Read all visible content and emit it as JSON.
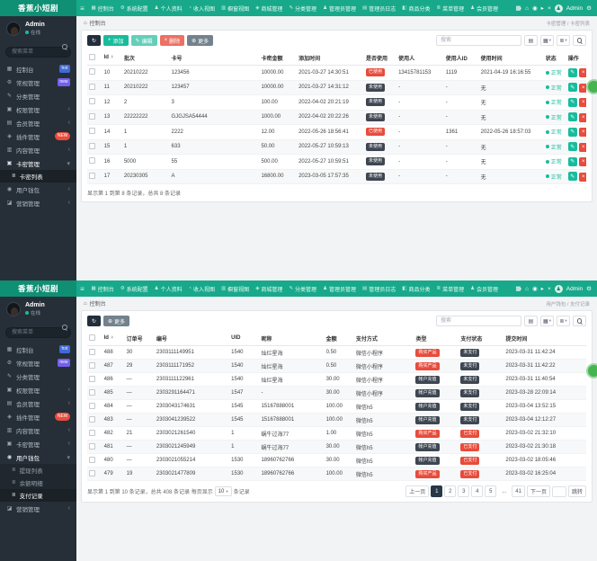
{
  "colors": {
    "navbar_green": "#18a98b",
    "logo_green": "#0f8f74",
    "sidebar_dark": "#262f38",
    "accent_green": "#18bc9c",
    "danger_red": "#e74c3c",
    "dark_badge": "#3e4651",
    "badge_hot_blue": "#3f6ad8",
    "badge_new_purple": "#7460ee",
    "pager_active_dark": "#293846",
    "fab_green": "#46b450"
  },
  "screens": [
    {
      "logo": "香蕉小短剧",
      "navbar": {
        "items": [
          {
            "label": "控制台",
            "icon": "dashboard-icon"
          },
          {
            "label": "系统配置",
            "icon": "gear-icon"
          },
          {
            "label": "个人资料",
            "icon": "user-icon"
          },
          {
            "label": "收入视图",
            "icon": "chart-line-icon"
          },
          {
            "label": "橱窗视图",
            "icon": "chart-bar-icon"
          },
          {
            "label": "商城管理",
            "icon": "cart-icon"
          },
          {
            "label": "分类管理",
            "icon": "pencil-icon"
          },
          {
            "label": "管理员管理",
            "icon": "users-icon"
          },
          {
            "label": "管理员日志",
            "icon": "log-icon"
          },
          {
            "label": "商品分类",
            "icon": "tags-icon"
          },
          {
            "label": "菜单管理",
            "icon": "list-icon"
          },
          {
            "label": "会员管理",
            "icon": "member-icon"
          }
        ],
        "user_name": "Admin"
      },
      "sidebar": {
        "user_name": "Admin",
        "user_status": "在线",
        "search_placeholder": "搜索菜单",
        "menu": [
          {
            "label": "控制台",
            "icon": "dashboard-icon",
            "badge": "hot",
            "badge_style": "blue"
          },
          {
            "label": "常规管理",
            "icon": "sliders-icon",
            "badge": "new",
            "badge_style": "purple"
          },
          {
            "label": "分类管理",
            "icon": "pencil-icon"
          },
          {
            "label": "权限管理",
            "icon": "shield-icon",
            "caret": true
          },
          {
            "label": "会员管理",
            "icon": "table-icon",
            "caret": true
          },
          {
            "label": "插件管理",
            "icon": "plugin-icon",
            "badge": "NEW",
            "badge_style": "red-pill"
          },
          {
            "label": "内容管理",
            "icon": "folder-icon",
            "caret": true
          },
          {
            "label": "卡密管理",
            "icon": "card-icon",
            "expanded": true,
            "subs": [
              {
                "label": "卡密列表",
                "icon": "list-icon",
                "active": true
              }
            ]
          },
          {
            "label": "用户钱包",
            "icon": "wallet-icon",
            "caret": true
          },
          {
            "label": "营销管理",
            "icon": "chart-icon",
            "caret": true
          }
        ]
      },
      "breadcrumb": {
        "home": "控制台",
        "trail": "卡密管理 / 卡密列表"
      },
      "toolbar": [
        {
          "name": "refresh-button",
          "label": "",
          "icon": "refresh-icon",
          "style": "dark"
        },
        {
          "name": "add-button",
          "label": "添加",
          "icon": "plus-icon",
          "style": "success"
        },
        {
          "name": "edit-button",
          "label": "编辑",
          "icon": "pencil-icon",
          "style": "success-light"
        },
        {
          "name": "delete-button",
          "label": "删除",
          "icon": "trash-icon",
          "style": "danger"
        },
        {
          "name": "more-button",
          "label": "更多",
          "icon": "more-icon",
          "style": "secondary"
        }
      ],
      "search_placeholder": "搜索",
      "table": {
        "columns": [
          "Id",
          "批次",
          "卡号",
          "卡密金额",
          "添加时间",
          "是否使用",
          "使用人",
          "使用人ID",
          "使用时间",
          "状态",
          "操作"
        ],
        "rows": [
          [
            "10",
            "20210222",
            "123456",
            "10000.00",
            "2021-03-27 14:30:51",
            {
              "b": "已使用",
              "s": "red"
            },
            "13415781153",
            "1119",
            "2021-04-19 16:16:55",
            {
              "st": "正常"
            },
            {
              "ops": [
                "edit",
                "delete"
              ]
            }
          ],
          [
            "11",
            "20210222",
            "123457",
            "10000.00",
            "2021-03-27 14:31:12",
            {
              "b": "未使用",
              "s": "dark"
            },
            "-",
            "-",
            "无",
            {
              "st": "正常"
            },
            {
              "ops": [
                "edit",
                "delete"
              ]
            }
          ],
          [
            "12",
            "2",
            "3",
            "100.00",
            "2022-04-02 20:21:19",
            {
              "b": "未使用",
              "s": "dark"
            },
            "-",
            "-",
            "无",
            {
              "st": "正常"
            },
            {
              "ops": [
                "edit",
                "delete"
              ]
            }
          ],
          [
            "13",
            "22222222",
            "GJGJSA54444",
            "1000.00",
            "2022-04-02 20:22:26",
            {
              "b": "未使用",
              "s": "dark"
            },
            "-",
            "-",
            "无",
            {
              "st": "正常"
            },
            {
              "ops": [
                "edit",
                "delete"
              ]
            }
          ],
          [
            "14",
            "1",
            "2222",
            "12.00",
            "2022-05-26 18:56:41",
            {
              "b": "已使用",
              "s": "red"
            },
            "-",
            "1361",
            "2022-05-26 18:57:03",
            {
              "st": "正常"
            },
            {
              "ops": [
                "edit",
                "delete"
              ]
            }
          ],
          [
            "15",
            "1",
            "633",
            "50.00",
            "2022-05-27 10:59:13",
            {
              "b": "未使用",
              "s": "dark"
            },
            "-",
            "-",
            "无",
            {
              "st": "正常"
            },
            {
              "ops": [
                "edit",
                "delete"
              ]
            }
          ],
          [
            "16",
            "5000",
            "55",
            "500.00",
            "2022-05-27 10:59:51",
            {
              "b": "未使用",
              "s": "dark"
            },
            "-",
            "-",
            "无",
            {
              "st": "正常"
            },
            {
              "ops": [
                "edit",
                "delete"
              ]
            }
          ],
          [
            "17",
            "20230305",
            "A",
            "16800.00",
            "2023-03-05 17:57:35",
            {
              "b": "未使用",
              "s": "dark"
            },
            "-",
            "-",
            "无",
            {
              "st": "正常"
            },
            {
              "ops": [
                "edit",
                "delete"
              ]
            }
          ]
        ]
      },
      "footer_text": "显示第 1 到第 8 条记录，总共 8 条记录"
    },
    {
      "logo": "香蕉小短剧",
      "navbar": {
        "items": [
          {
            "label": "控制台",
            "icon": "dashboard-icon"
          },
          {
            "label": "系统配置",
            "icon": "gear-icon"
          },
          {
            "label": "个人资料",
            "icon": "user-icon"
          },
          {
            "label": "收入视图",
            "icon": "chart-line-icon"
          },
          {
            "label": "橱窗视图",
            "icon": "chart-bar-icon"
          },
          {
            "label": "商城管理",
            "icon": "cart-icon"
          },
          {
            "label": "分类管理",
            "icon": "pencil-icon"
          },
          {
            "label": "管理员管理",
            "icon": "users-icon"
          },
          {
            "label": "管理员日志",
            "icon": "log-icon"
          },
          {
            "label": "商品分类",
            "icon": "tags-icon"
          },
          {
            "label": "菜单管理",
            "icon": "list-icon"
          },
          {
            "label": "会员管理",
            "icon": "member-icon"
          }
        ],
        "user_name": "Admin"
      },
      "sidebar": {
        "user_name": "Admin",
        "user_status": "在线",
        "search_placeholder": "搜索菜单",
        "menu": [
          {
            "label": "控制台",
            "icon": "dashboard-icon",
            "badge": "hot",
            "badge_style": "blue"
          },
          {
            "label": "常规管理",
            "icon": "sliders-icon",
            "badge": "new",
            "badge_style": "purple"
          },
          {
            "label": "分类管理",
            "icon": "pencil-icon"
          },
          {
            "label": "权限管理",
            "icon": "shield-icon",
            "caret": true
          },
          {
            "label": "会员管理",
            "icon": "table-icon",
            "caret": true
          },
          {
            "label": "插件管理",
            "icon": "plugin-icon",
            "badge": "NEW",
            "badge_style": "red-pill"
          },
          {
            "label": "内容管理",
            "icon": "folder-icon",
            "caret": true
          },
          {
            "label": "卡密管理",
            "icon": "card-icon",
            "caret": true
          },
          {
            "label": "用户钱包",
            "icon": "wallet-icon",
            "expanded": true,
            "subs": [
              {
                "label": "提现列表",
                "icon": "list-icon"
              },
              {
                "label": "余额明细",
                "icon": "list-icon"
              },
              {
                "label": "支付记录",
                "icon": "list-icon",
                "active": true
              }
            ]
          },
          {
            "label": "营销管理",
            "icon": "chart-icon",
            "caret": true
          }
        ]
      },
      "breadcrumb": {
        "home": "控制台",
        "trail": "用户钱包 / 支付记录"
      },
      "toolbar": [
        {
          "name": "refresh-button",
          "label": "",
          "icon": "refresh-icon",
          "style": "dark"
        },
        {
          "name": "more-button",
          "label": "更多",
          "icon": "more-icon",
          "style": "secondary"
        }
      ],
      "search_placeholder": "搜索",
      "table": {
        "columns": [
          "Id",
          "订单号",
          "编号",
          "UID",
          "昵称",
          "金额",
          "支付方式",
          "类型",
          "支付状态",
          "提交时间"
        ],
        "rows": [
          [
            "488",
            "30",
            "2303111149951",
            "1540",
            "灿烂星海",
            "0.50",
            "微信小程序",
            {
              "b": "购买产品",
              "s": "red"
            },
            {
              "b": "未支付",
              "s": "dark"
            },
            "2023-03-31 11:42:24"
          ],
          [
            "487",
            "29",
            "2303111171952",
            "1540",
            "灿烂星海",
            "0.50",
            "微信小程序",
            {
              "b": "购买产品",
              "s": "red"
            },
            {
              "b": "未支付",
              "s": "dark"
            },
            "2023-03-31 11:42:22"
          ],
          [
            "486",
            "—",
            "2303111122961",
            "1540",
            "灿烂星海",
            "30.00",
            "微信小程序",
            {
              "b": "帐户充值",
              "s": "dark"
            },
            {
              "b": "未支付",
              "s": "dark"
            },
            "2023-03-31 11:40:54"
          ],
          [
            "485",
            "—",
            "2303291164471",
            "1547",
            "-",
            "30.00",
            "微信小程序",
            {
              "b": "帐户充值",
              "s": "dark"
            },
            {
              "b": "未支付",
              "s": "dark"
            },
            "2023-03-28 22:09:14"
          ],
          [
            "484",
            "—",
            "2303043174631",
            "1545",
            "15167888001",
            "100.00",
            "微信h5",
            {
              "b": "帐户充值",
              "s": "dark"
            },
            {
              "b": "未支付",
              "s": "dark"
            },
            "2023-03-04 13:52:15"
          ],
          [
            "483",
            "—",
            "2303041239522",
            "1545",
            "15167888001",
            "100.00",
            "微信h5",
            {
              "b": "帐户充值",
              "s": "dark"
            },
            {
              "b": "未支付",
              "s": "dark"
            },
            "2023-03-04 12:12:27"
          ],
          [
            "482",
            "21",
            "2303021261540",
            "1",
            "蜗牛过海77",
            "1.00",
            "微信h5",
            {
              "b": "购买产品",
              "s": "red"
            },
            {
              "b": "已支付",
              "s": "red"
            },
            "2023-03-02 21:32:10"
          ],
          [
            "481",
            "—",
            "2303021245949",
            "1",
            "蜗牛过海77",
            "30.00",
            "微信h5",
            {
              "b": "帐户充值",
              "s": "dark"
            },
            {
              "b": "已支付",
              "s": "red"
            },
            "2023-03-02 21:30:18"
          ],
          [
            "480",
            "—",
            "2303021055214",
            "1530",
            "18960762766",
            "30.00",
            "微信h5",
            {
              "b": "帐户充值",
              "s": "dark"
            },
            {
              "b": "已支付",
              "s": "red"
            },
            "2023-03-02 18:05:46"
          ],
          [
            "479",
            "19",
            "2303021477809",
            "1530",
            "18960762766",
            "100.00",
            "微信h5",
            {
              "b": "购买产品",
              "s": "red"
            },
            {
              "b": "已支付",
              "s": "red"
            },
            "2023-03-02 16:25:04"
          ]
        ]
      },
      "footer_text_before": "显示第 1 到第 10 条记录，总共 408 条记录 每页显示",
      "per_page": "10",
      "footer_text_after": "条记录",
      "pagination": {
        "prev": "上一页",
        "pages": [
          "1",
          "2",
          "3",
          "4",
          "5",
          "...",
          "41"
        ],
        "active": "1",
        "next": "下一页",
        "jump": "跳转"
      }
    }
  ]
}
